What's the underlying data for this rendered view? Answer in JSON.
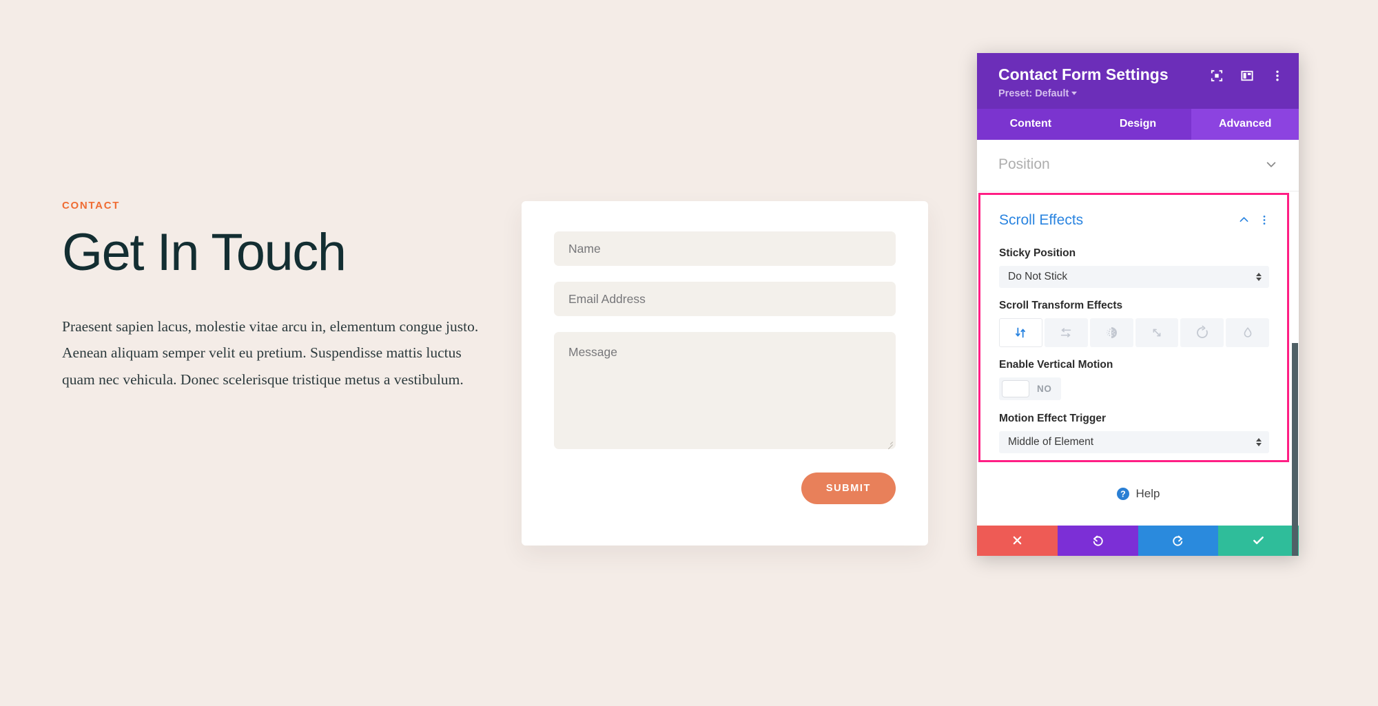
{
  "page": {
    "background_color": "#f4ece7",
    "eyebrow": "CONTACT",
    "eyebrow_color": "#ef6c33",
    "headline": "Get In Touch",
    "headline_color": "#132e32",
    "body": "Praesent sapien lacus, molestie vitae arcu in, elementum congue justo. Aenean aliquam semper velit eu pretium. Suspendisse mattis luctus quam nec vehicula. Donec scelerisque tristique metus a vestibulum."
  },
  "form": {
    "name_placeholder": "Name",
    "email_placeholder": "Email Address",
    "message_placeholder": "Message",
    "submit_label": "SUBMIT",
    "submit_color": "#e8805a"
  },
  "modal": {
    "title": "Contact Form Settings",
    "preset_label": "Preset: Default",
    "header_color": "#6c2eb9",
    "header_icons": [
      {
        "name": "focus-icon"
      },
      {
        "name": "layout-panel-icon"
      },
      {
        "name": "more-vertical-icon"
      }
    ],
    "tabs": [
      {
        "label": "Content",
        "active": false
      },
      {
        "label": "Design",
        "active": false
      },
      {
        "label": "Advanced",
        "active": true
      }
    ],
    "sections": {
      "position": {
        "label": "Position",
        "expanded": false
      },
      "scroll_effects": {
        "label": "Scroll Effects",
        "label_color": "#2a84e0",
        "expanded": true,
        "highlight_color": "#ff1e84",
        "sticky_position": {
          "label": "Sticky Position",
          "value": "Do Not Stick"
        },
        "scroll_transform_effects": {
          "label": "Scroll Transform Effects",
          "options": [
            {
              "name": "vertical-motion-icon",
              "active": true
            },
            {
              "name": "horizontal-motion-icon",
              "active": false
            },
            {
              "name": "fade-icon",
              "active": false
            },
            {
              "name": "scale-icon",
              "active": false
            },
            {
              "name": "rotate-icon",
              "active": false
            },
            {
              "name": "blur-icon",
              "active": false
            }
          ]
        },
        "enable_vertical_motion": {
          "label": "Enable Vertical Motion",
          "value": "NO",
          "enabled": false
        },
        "motion_effect_trigger": {
          "label": "Motion Effect Trigger",
          "value": "Middle of Element"
        }
      }
    },
    "help": {
      "label": "Help"
    },
    "actions": [
      {
        "name": "cancel-button",
        "color": "#ee5b55"
      },
      {
        "name": "undo-button",
        "color": "#7c2fd6"
      },
      {
        "name": "redo-button",
        "color": "#2a8add"
      },
      {
        "name": "save-button",
        "color": "#2fbd9a"
      }
    ]
  }
}
